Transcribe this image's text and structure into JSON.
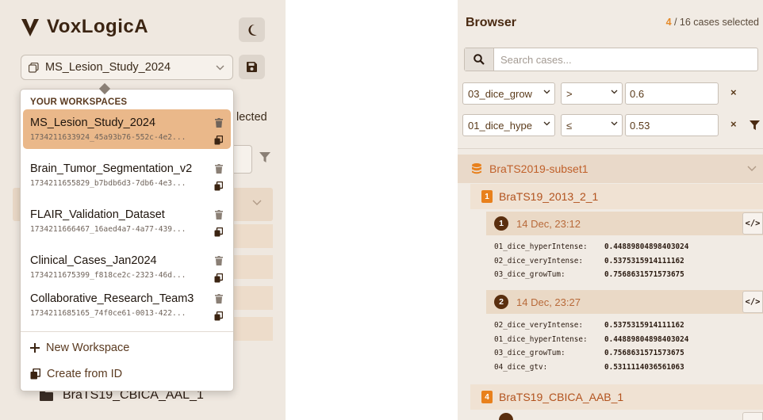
{
  "left": {
    "app_name": "VoxLogicA",
    "workspace_select": {
      "value": "MS_Lesion_Study_2024"
    },
    "bg_selected_text": "lected",
    "case_row": {
      "label": "BraTS19_CBICA_AAL_1"
    },
    "dropdown": {
      "header": "YOUR WORKSPACES",
      "workspaces": [
        {
          "name": "MS_Lesion_Study_2024",
          "id": "1734211633924_45a93b76-552c-4e2...",
          "active": true
        },
        {
          "name": "Brain_Tumor_Segmentation_v2",
          "id": "1734211655829_b7bdb6d3-7db6-4e3...",
          "active": false
        },
        {
          "name": "FLAIR_Validation_Dataset",
          "id": "1734211666467_16aed4a7-4a77-439...",
          "active": false
        },
        {
          "name": "Clinical_Cases_Jan2024",
          "id": "1734211675399_f818ce2c-2323-46d...",
          "active": false
        },
        {
          "name": "Collaborative_Research_Team3",
          "id": "1734211685165_74f0ce61-0013-422...",
          "active": false
        }
      ],
      "new_workspace": "New Workspace",
      "create_from_id": "Create from ID"
    }
  },
  "right": {
    "title": "Browser",
    "selected_count": "4",
    "selected_rest": " / 16 cases selected",
    "search_placeholder": "Search cases...",
    "filters": [
      {
        "field": "03_dice_grow",
        "op": ">",
        "value": "0.6",
        "remove": "×"
      },
      {
        "field": "01_dice_hype",
        "op": "≤",
        "value": "0.53",
        "remove": "×"
      }
    ],
    "dataset": {
      "label": "BraTS2019-subset1"
    },
    "cases": [
      {
        "number": "1",
        "name": "BraTS19_2013_2_1",
        "runs": [
          {
            "number": "1",
            "time": "14 Dec, 23:12",
            "code_label": "</>",
            "metrics": [
              {
                "key": "01_dice_hyperIntense:",
                "value": "0.44889804898403024"
              },
              {
                "key": "02_dice_veryIntense:",
                "value": "0.5375315914111162"
              },
              {
                "key": "03_dice_growTum:",
                "value": "0.7568631571573675"
              }
            ]
          },
          {
            "number": "2",
            "time": "14 Dec, 23:27",
            "code_label": "</>",
            "metrics": [
              {
                "key": "02_dice_veryIntense:",
                "value": "0.5375315914111162"
              },
              {
                "key": "01_dice_hyperIntense:",
                "value": "0.44889804898403024"
              },
              {
                "key": "03_dice_growTum:",
                "value": "0.7568631571573675"
              },
              {
                "key": "04_dice_gtv:",
                "value": "0.5311114036561063"
              }
            ]
          }
        ]
      },
      {
        "number": "4",
        "name": "BraTS19_CBICA_AAB_1",
        "runs": []
      }
    ]
  },
  "colors": {
    "accent": "#e8801c",
    "active_workspace": "#eab88a",
    "brand_dark": "#3b2412",
    "case_text": "#b2521d",
    "run_badge": "#5a2e0e"
  },
  "icons": {
    "logo": "voxlogica-logo-icon",
    "theme": "moon-icon",
    "workspace": "workspace-icon",
    "save": "save-icon",
    "filter": "filter-icon",
    "search": "search-icon",
    "trash": "trash-icon",
    "copy": "copy-icon",
    "plus": "plus-icon",
    "folder": "folder-icon",
    "database": "database-icon",
    "code": "code-icon",
    "chevron": "chevron-down-icon"
  }
}
